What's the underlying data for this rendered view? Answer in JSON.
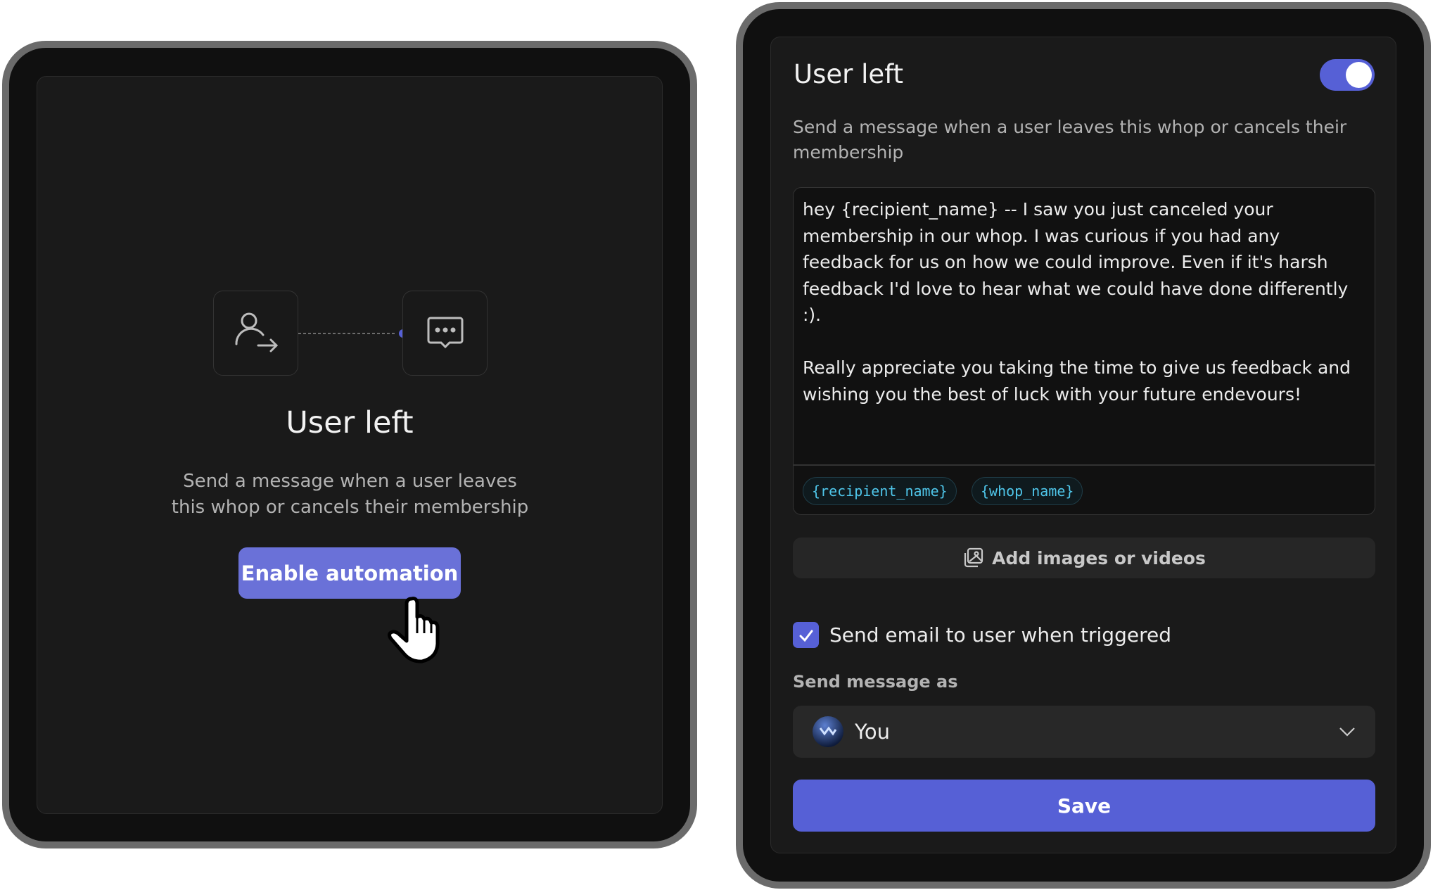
{
  "colors": {
    "accent": "#5660d6",
    "button_left": "#6a71d8",
    "tag_text": "#4fc6ea",
    "panel": "#1a1a1a"
  },
  "left_card": {
    "trigger_icon": "user-leave-icon",
    "action_icon": "chat-bubble-dots-icon",
    "title": "User left",
    "description": "Send a message when a user leaves this whop or cancels their membership",
    "enable_button": "Enable automation",
    "cursor": "hand-pointer-icon"
  },
  "right_card": {
    "title": "User left",
    "toggle_on": true,
    "description": "Send a message when a user leaves this whop or cancels their membership",
    "message": "hey {recipient_name} -- I saw you just canceled your membership in our whop. I was curious if you had any feedback for us on how we could improve. Even if it's harsh feedback I'd love to hear what we could have done differently :).\n\nReally appreciate you taking the time to give us feedback and wishing you the best of luck with your future endevours!",
    "tags": [
      "{recipient_name}",
      "{whop_name}"
    ],
    "add_media_label": "Add images or videos",
    "email_checkbox_label": "Send email to user when triggered",
    "email_checked": true,
    "send_as_label": "Send message as",
    "send_as_value": "You",
    "save_label": "Save"
  }
}
